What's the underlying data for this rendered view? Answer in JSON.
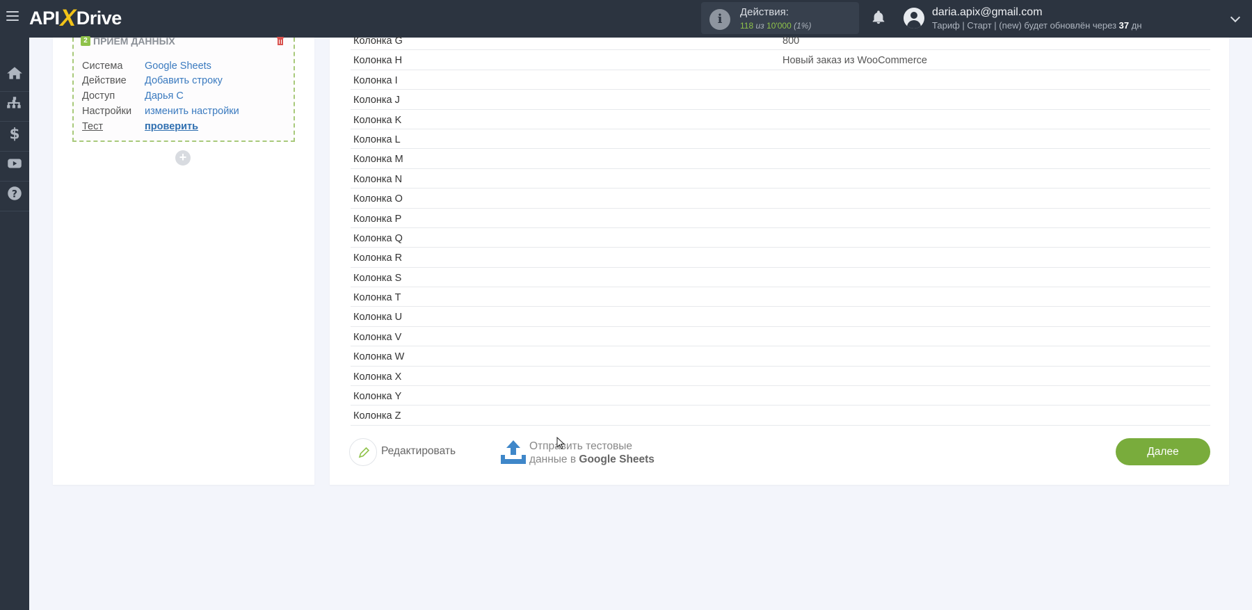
{
  "header": {
    "logo_left": "API",
    "logo_x": "X",
    "logo_right": "Drive",
    "actions_title": "Действия:",
    "actions_used": "118",
    "actions_of": "из",
    "actions_total": "10'000",
    "actions_pct": "(1%)",
    "user_email": "daria.apix@gmail.com",
    "plan_prefix": "Тариф | Старт | (new) будет обновлён через",
    "plan_days": "37",
    "plan_suffix": "дн"
  },
  "rail_icons": [
    "home-icon",
    "sitemap-icon",
    "dollar-icon",
    "youtube-icon",
    "help-icon"
  ],
  "step": {
    "number": "2",
    "title": "ПРИЕМ ДАННЫХ",
    "fields": [
      {
        "key": "Система",
        "value": "Google Sheets"
      },
      {
        "key": "Действие",
        "value": "Добавить строку"
      },
      {
        "key": "Доступ",
        "value": "Дарья С"
      },
      {
        "key": "Настройки",
        "value": "изменить настройки"
      },
      {
        "key": "Тест",
        "value": "проверить"
      }
    ]
  },
  "columns": [
    {
      "name": "Колонка G",
      "value": "800"
    },
    {
      "name": "Колонка H",
      "value": "Новый заказ из WooCommerce"
    },
    {
      "name": "Колонка I",
      "value": ""
    },
    {
      "name": "Колонка J",
      "value": ""
    },
    {
      "name": "Колонка K",
      "value": ""
    },
    {
      "name": "Колонка L",
      "value": ""
    },
    {
      "name": "Колонка M",
      "value": ""
    },
    {
      "name": "Колонка N",
      "value": ""
    },
    {
      "name": "Колонка O",
      "value": ""
    },
    {
      "name": "Колонка P",
      "value": ""
    },
    {
      "name": "Колонка Q",
      "value": ""
    },
    {
      "name": "Колонка R",
      "value": ""
    },
    {
      "name": "Колонка S",
      "value": ""
    },
    {
      "name": "Колонка T",
      "value": ""
    },
    {
      "name": "Колонка U",
      "value": ""
    },
    {
      "name": "Колонка V",
      "value": ""
    },
    {
      "name": "Колонка W",
      "value": ""
    },
    {
      "name": "Колонка X",
      "value": ""
    },
    {
      "name": "Колонка Y",
      "value": ""
    },
    {
      "name": "Колонка Z",
      "value": ""
    }
  ],
  "footer": {
    "edit_label": "Редактировать",
    "send_line1": "Отправить тестовые",
    "send_line2_prefix": "данные в",
    "send_line2_bold": "Google Sheets",
    "next_label": "Далее"
  },
  "colors": {
    "topbar": "#2c3440",
    "accent_green": "#79ac3c",
    "link_blue": "#3a7abf",
    "logo_yellow": "#f2c318"
  }
}
